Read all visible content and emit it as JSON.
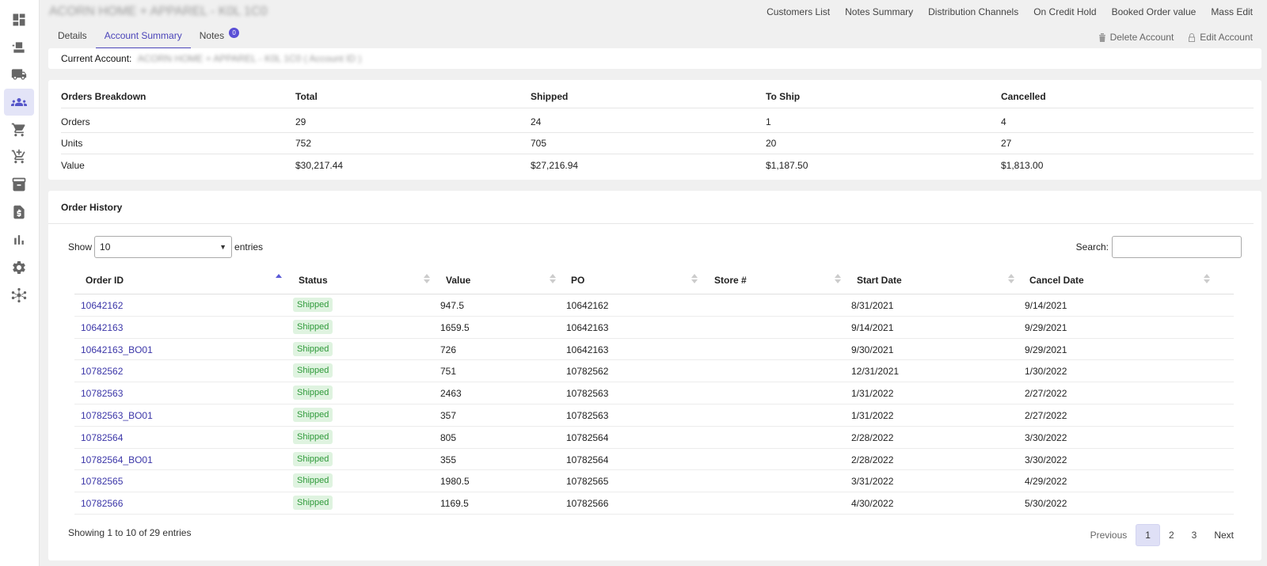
{
  "app": {
    "title": "ACORN HOME + APPAREL - K0L 1C0"
  },
  "sidebar": {
    "items": [
      {
        "icon": "dashboard-icon",
        "active": false
      },
      {
        "icon": "inbox-icon",
        "active": false
      },
      {
        "icon": "truck-icon",
        "active": false
      },
      {
        "icon": "customers-icon",
        "active": true
      },
      {
        "icon": "cart-icon",
        "active": false
      },
      {
        "icon": "cart-add-icon",
        "active": false
      },
      {
        "icon": "archive-icon",
        "active": false
      },
      {
        "icon": "invoice-icon",
        "active": false
      },
      {
        "icon": "bar-chart-icon",
        "active": false
      },
      {
        "icon": "gear-icon",
        "active": false
      },
      {
        "icon": "hub-icon",
        "active": false
      }
    ]
  },
  "top_links": [
    "Customers List",
    "Notes Summary",
    "Distribution Channels",
    "On Credit Hold",
    "Booked Order value",
    "Mass Edit"
  ],
  "tabs": [
    {
      "label": "Details",
      "active": false
    },
    {
      "label": "Account Summary",
      "active": true
    },
    {
      "label": "Notes",
      "active": false,
      "badge": "0"
    }
  ],
  "actions": {
    "delete": "Delete Account",
    "edit": "Edit Account"
  },
  "current_account": {
    "label": "Current Account:",
    "value": "ACORN HOME + APPAREL - K0L 1C0 ( Account ID )"
  },
  "breakdown": {
    "headers": [
      "Orders Breakdown",
      "Total",
      "Shipped",
      "To Ship",
      "Cancelled"
    ],
    "rows": [
      [
        "Orders",
        "29",
        "24",
        "1",
        "4"
      ],
      [
        "Units",
        "752",
        "705",
        "20",
        "27"
      ],
      [
        "Value",
        "$30,217.44",
        "$27,216.94",
        "$1,187.50",
        "$1,813.00"
      ]
    ]
  },
  "history": {
    "title": "Order History",
    "show_label": "Show",
    "entries_label": "entries",
    "page_size": "10",
    "search_label": "Search:",
    "search_value": "",
    "columns": [
      "Order ID",
      "Status",
      "Value",
      "PO",
      "Store #",
      "Start Date",
      "Cancel Date"
    ],
    "rows": [
      {
        "id": "10642162",
        "status": "Shipped",
        "value": "947.5",
        "po": "10642162",
        "store": "",
        "start": "8/31/2021",
        "cancel": "9/14/2021"
      },
      {
        "id": "10642163",
        "status": "Shipped",
        "value": "1659.5",
        "po": "10642163",
        "store": "",
        "start": "9/14/2021",
        "cancel": "9/29/2021"
      },
      {
        "id": "10642163_BO01",
        "status": "Shipped",
        "value": "726",
        "po": "10642163",
        "store": "",
        "start": "9/30/2021",
        "cancel": "9/29/2021"
      },
      {
        "id": "10782562",
        "status": "Shipped",
        "value": "751",
        "po": "10782562",
        "store": "",
        "start": "12/31/2021",
        "cancel": "1/30/2022"
      },
      {
        "id": "10782563",
        "status": "Shipped",
        "value": "2463",
        "po": "10782563",
        "store": "",
        "start": "1/31/2022",
        "cancel": "2/27/2022"
      },
      {
        "id": "10782563_BO01",
        "status": "Shipped",
        "value": "357",
        "po": "10782563",
        "store": "",
        "start": "1/31/2022",
        "cancel": "2/27/2022"
      },
      {
        "id": "10782564",
        "status": "Shipped",
        "value": "805",
        "po": "10782564",
        "store": "",
        "start": "2/28/2022",
        "cancel": "3/30/2022"
      },
      {
        "id": "10782564_BO01",
        "status": "Shipped",
        "value": "355",
        "po": "10782564",
        "store": "",
        "start": "2/28/2022",
        "cancel": "3/30/2022"
      },
      {
        "id": "10782565",
        "status": "Shipped",
        "value": "1980.5",
        "po": "10782565",
        "store": "",
        "start": "3/31/2022",
        "cancel": "4/29/2022"
      },
      {
        "id": "10782566",
        "status": "Shipped",
        "value": "1169.5",
        "po": "10782566",
        "store": "",
        "start": "4/30/2022",
        "cancel": "5/30/2022"
      }
    ],
    "info": "Showing 1 to 10 of 29 entries",
    "pagination": {
      "previous": "Previous",
      "pages": [
        "1",
        "2",
        "3"
      ],
      "current": "1",
      "next": "Next"
    }
  },
  "colors": {
    "accent": "#4a44b9",
    "shipped_bg": "#dff3e0",
    "shipped_text": "#2f9a3a",
    "page_bg": "#f0f0f0"
  }
}
